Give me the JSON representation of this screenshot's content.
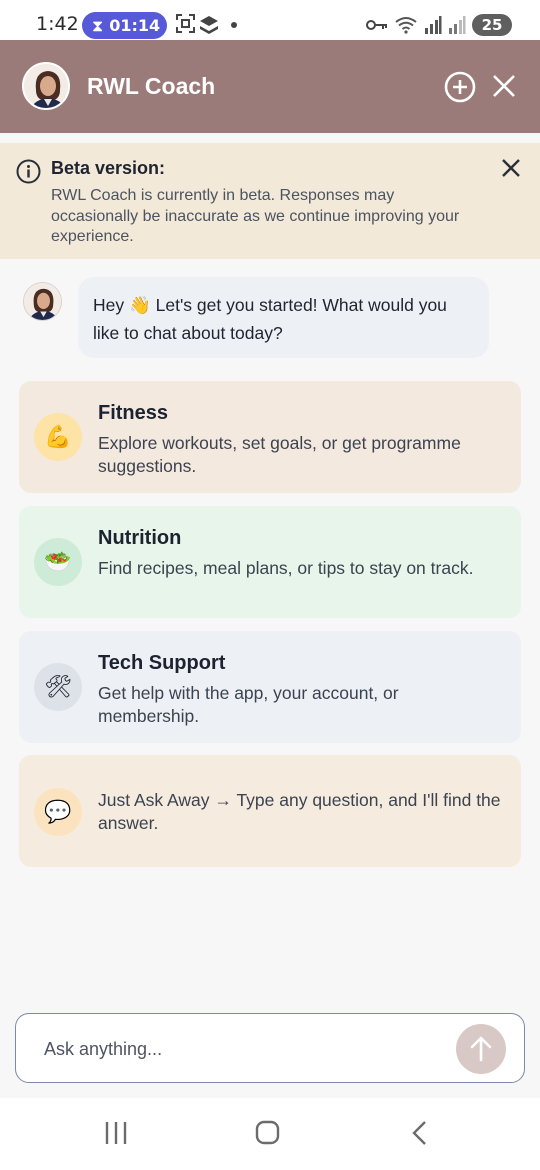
{
  "status_bar": {
    "time": "1:42",
    "timer": "01:14",
    "battery": "25",
    "icons_left": [
      "screenshot-icon",
      "layers-icon",
      "dot-icon"
    ],
    "icons_right": [
      "key-icon",
      "wifi-icon",
      "signal-icon",
      "signal-icon",
      "battery-icon"
    ]
  },
  "header": {
    "title": "RWL Coach",
    "background": "#9a7b79",
    "add_icon": "plus-circle-icon",
    "close_icon": "close-icon"
  },
  "beta_notice": {
    "title": "Beta version:",
    "text": "RWL Coach is currently in beta. Responses may occasionally be inaccurate as we continue improving your experience.",
    "background": "#f2e9d8"
  },
  "chat": {
    "message": "Hey 👋 Let's get you started! What would you like to chat about today?"
  },
  "options": [
    {
      "title": "Fitness",
      "description": "Explore workouts, set goals, or get programme suggestions.",
      "icon": "💪",
      "icon_name": "flexed-bicep-icon",
      "color": "#f3e9df"
    },
    {
      "title": "Nutrition",
      "description": "Find recipes, meal plans, or tips to stay on track.",
      "icon": "🥗",
      "icon_name": "salad-icon",
      "color": "#e7f5ea"
    },
    {
      "title": "Tech Support",
      "description": "Get help with the app, your account, or membership.",
      "icon": "🛠",
      "icon_name": "tools-icon",
      "color": "#edf1f6"
    },
    {
      "title": "",
      "description": "Just Ask Away → Type any question, and I'll find the answer.",
      "icon": "💬",
      "icon_name": "speech-bubble-icon",
      "color": "#f5ebdf"
    }
  ],
  "input": {
    "placeholder": "Ask anything...",
    "value": "",
    "send_icon": "arrow-up-icon"
  },
  "nav_bar": {
    "icons": [
      "recent-apps-icon",
      "home-icon",
      "back-icon"
    ]
  }
}
